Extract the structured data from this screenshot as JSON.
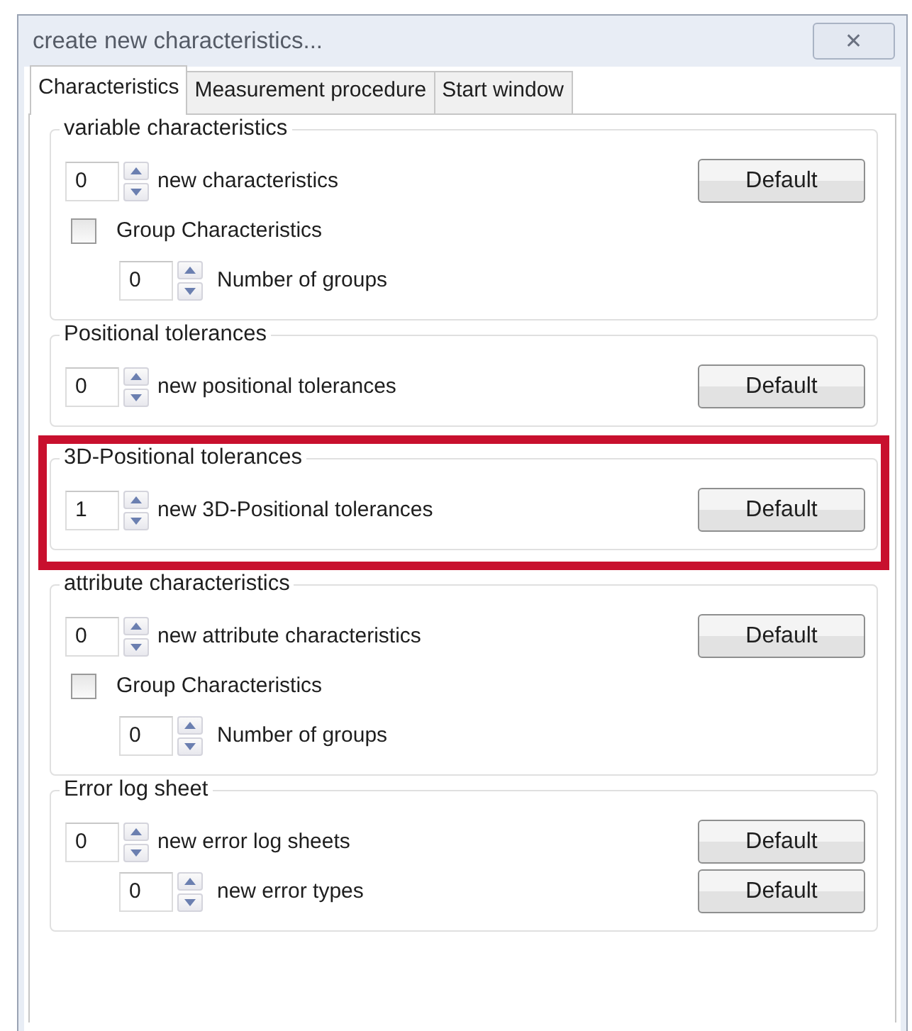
{
  "window": {
    "title": "create new characteristics...",
    "close_icon": "✕"
  },
  "tabs": [
    {
      "label": "Characteristics",
      "selected": true
    },
    {
      "label": "Measurement procedure",
      "selected": false
    },
    {
      "label": "Start window",
      "selected": false
    }
  ],
  "groups": [
    {
      "title": "variable characteristics",
      "highlighted": false,
      "rows": [
        {
          "kind": "spinner",
          "value": "0",
          "label": "new characteristics",
          "button": "Default"
        },
        {
          "kind": "checkbox",
          "label": "Group Characteristics",
          "checked": false,
          "children": [
            {
              "kind": "spinner",
              "value": "0",
              "label": "Number of groups"
            }
          ]
        }
      ]
    },
    {
      "title": "Positional tolerances",
      "highlighted": false,
      "rows": [
        {
          "kind": "spinner",
          "value": "0",
          "label": "new positional tolerances",
          "button": "Default"
        }
      ]
    },
    {
      "title": "3D-Positional tolerances",
      "highlighted": true,
      "rows": [
        {
          "kind": "spinner",
          "value": "1",
          "label": "new 3D-Positional tolerances",
          "button": "Default"
        }
      ]
    },
    {
      "title": "attribute characteristics",
      "highlighted": false,
      "rows": [
        {
          "kind": "spinner",
          "value": "0",
          "label": "new attribute characteristics",
          "button": "Default"
        },
        {
          "kind": "checkbox",
          "label": "Group Characteristics",
          "checked": false,
          "children": [
            {
              "kind": "spinner",
              "value": "0",
              "label": "Number of groups"
            }
          ]
        }
      ]
    },
    {
      "title": "Error log sheet",
      "highlighted": false,
      "rows": [
        {
          "kind": "spinner",
          "value": "0",
          "label": "new error log sheets",
          "button": "Default",
          "children": [
            {
              "kind": "spinner",
              "value": "0",
              "label": "new error types",
              "button": "Default"
            }
          ]
        }
      ]
    }
  ]
}
